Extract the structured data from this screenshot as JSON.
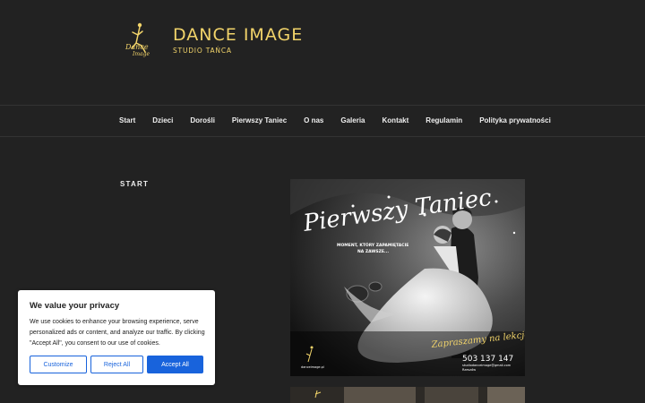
{
  "site": {
    "title": "DANCE IMAGE",
    "subtitle": "STUDIO TAŃCA"
  },
  "nav": {
    "items": [
      "Start",
      "Dzieci",
      "Dorośli",
      "Pierwszy Taniec",
      "O nas",
      "Galeria",
      "Kontakt",
      "Regulamin",
      "Polityka prywatności"
    ]
  },
  "page": {
    "title": "START"
  },
  "poster": {
    "headline": "Pierwszy Taniec",
    "tagline_1": "MOMENT, KTÓRY ZAPAMIĘTACIE",
    "tagline_2": "NA ZAWSZE...",
    "invite": "Zapraszamy na lekcje",
    "phone": "503 137 147",
    "email": "studiodanceimage@gmail.com",
    "location": "Rzeszów",
    "website": "danceimage.pl"
  },
  "cookie": {
    "title": "We value your privacy",
    "text": "We use cookies to enhance your browsing experience, serve personalized ads or content, and analyze our traffic. By clicking \"Accept All\", you consent to our use of cookies.",
    "customize_label": "Customize",
    "reject_label": "Reject All",
    "accept_label": "Accept All"
  },
  "colors": {
    "background": "#222222",
    "brand_gold": "#f2d46a",
    "cookie_accent": "#1863dc"
  }
}
